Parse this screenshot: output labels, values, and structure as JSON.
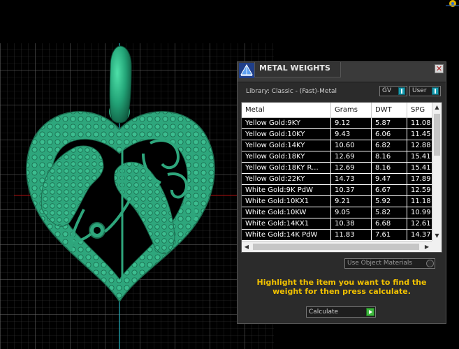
{
  "panel": {
    "title": "METAL WEIGHTS",
    "close_label": "✕",
    "library_label": "Library: Classic - (Fast)-Metal",
    "toggles": [
      {
        "label": "GV"
      },
      {
        "label": "User"
      }
    ],
    "table": {
      "columns": [
        "Metal",
        "Grams",
        "DWT",
        "SPG"
      ],
      "rows": [
        [
          "Yellow Gold:9KY",
          "9.12",
          "5.87",
          "11.08"
        ],
        [
          "Yellow Gold:10KY",
          "9.43",
          "6.06",
          "11.45"
        ],
        [
          "Yellow Gold:14KY",
          "10.60",
          "6.82",
          "12.88"
        ],
        [
          "Yellow Gold:18KY",
          "12.69",
          "8.16",
          "15.41"
        ],
        [
          "Yellow Gold:18KY R...",
          "12.69",
          "8.16",
          "15.41"
        ],
        [
          "Yellow Gold:22KY",
          "14.73",
          "9.47",
          "17.89"
        ],
        [
          "White Gold:9K PdW",
          "10.37",
          "6.67",
          "12.59"
        ],
        [
          "White Gold:10KX1",
          "9.21",
          "5.92",
          "11.18"
        ],
        [
          "White Gold:10KW",
          "9.05",
          "5.82",
          "10.99"
        ],
        [
          "White Gold:14KX1",
          "10.38",
          "6.68",
          "12.61"
        ],
        [
          "White Gold:14K PdW",
          "11.83",
          "7.61",
          "14.37"
        ]
      ]
    },
    "use_object_materials_label": "Use Object Materials",
    "instructions": "Highlight the item you want to find the weight for then press calculate.",
    "calculate_label": "Calculate"
  },
  "colors": {
    "pendant_green": "#2ea67c",
    "pendant_dark": "#1b6e50",
    "instruction_yellow": "#f2c200",
    "grid_line": "#4a4a4a"
  }
}
